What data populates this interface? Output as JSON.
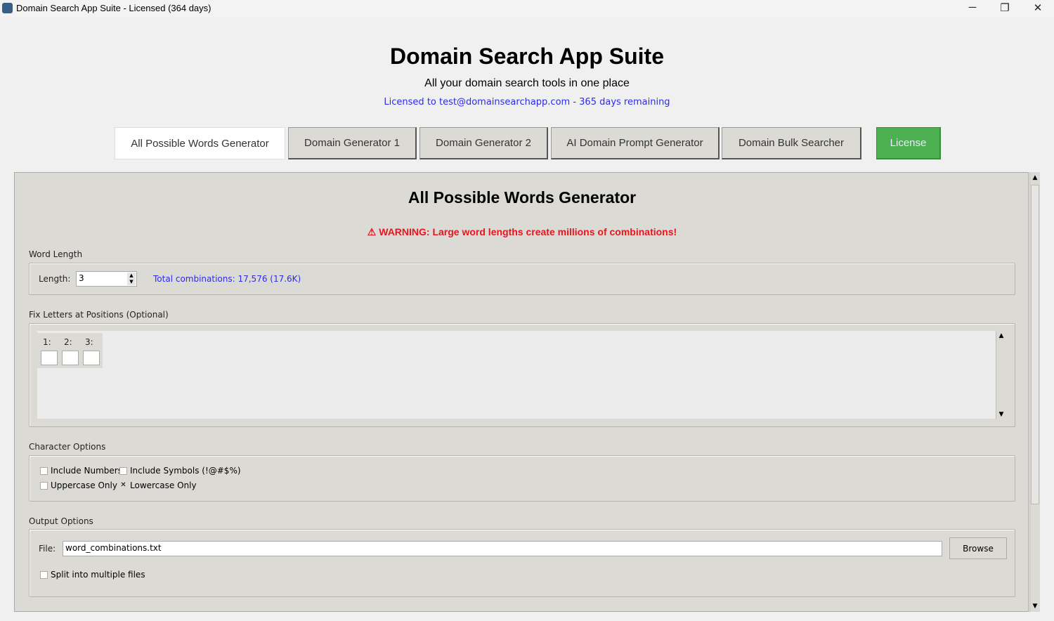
{
  "window": {
    "title": "Domain Search App Suite - Licensed (364 days)",
    "minimize": "─",
    "restore": "❐",
    "close": "✕"
  },
  "header": {
    "title": "Domain Search App Suite",
    "subtitle": "All your domain search tools in one place",
    "license_line": "Licensed to test@domainsearchapp.com - 365 days remaining"
  },
  "tabs": [
    {
      "label": "All Possible Words Generator"
    },
    {
      "label": "Domain Generator 1"
    },
    {
      "label": "Domain Generator 2"
    },
    {
      "label": "AI Domain Prompt Generator"
    },
    {
      "label": "Domain Bulk Searcher"
    },
    {
      "label": "License"
    }
  ],
  "panel": {
    "title": "All Possible Words Generator",
    "warning": "WARNING: Large word lengths create millions of combinations!",
    "word_length": {
      "section": "Word Length",
      "label": "Length:",
      "value": "3",
      "total": "Total combinations: 17,576 (17.6K)"
    },
    "fix_letters": {
      "section": "Fix Letters at Positions (Optional)",
      "positions": [
        {
          "label": "1:",
          "value": ""
        },
        {
          "label": "2:",
          "value": ""
        },
        {
          "label": "3:",
          "value": ""
        }
      ]
    },
    "char_options": {
      "section": "Character Options",
      "include_numbers": "Include Numbers",
      "include_symbols": "Include Symbols (!@#$%)",
      "uppercase_only": "Uppercase Only",
      "lowercase_only": "Lowercase Only",
      "checked": "✕"
    },
    "output": {
      "section": "Output Options",
      "file_label": "File:",
      "file_value": "word_combinations.txt",
      "browse": "Browse",
      "split": "Split into multiple files"
    }
  },
  "colors": {
    "license_green": "#4caf50",
    "warning_red": "#e8141e",
    "link_blue": "#2b2be8"
  }
}
